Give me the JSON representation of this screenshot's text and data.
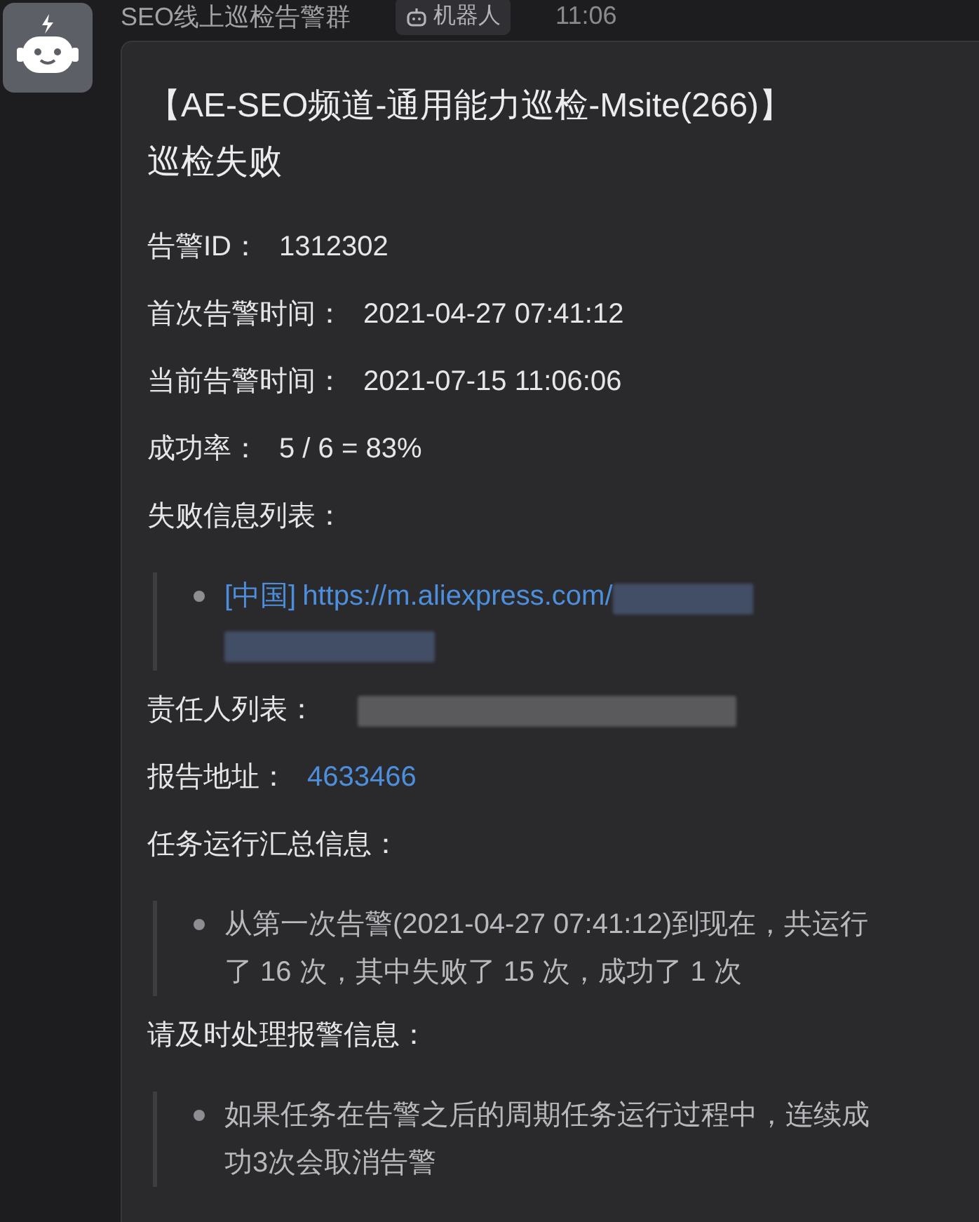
{
  "group": {
    "name": "SEO线上巡检告警群",
    "badge": "机器人",
    "time": "11:06"
  },
  "message": {
    "title_lines": [
      "【AE-SEO频道-通用能力巡检-Msite(266)】",
      "巡检失败"
    ],
    "sections": [
      {
        "kind": "field",
        "label": "告警ID：",
        "value": "1312302"
      },
      {
        "kind": "field",
        "label": "首次告警时间：",
        "value": "2021-04-27 07:41:12"
      },
      {
        "kind": "field",
        "label": "当前告警时间：",
        "value": "2021-07-15 11:06:06"
      },
      {
        "kind": "field",
        "label": "成功率：",
        "value": "5 / 6 = 83%"
      },
      {
        "kind": "list",
        "label": "失败信息列表：",
        "items": [
          {
            "tag": "[中国]",
            "link": "https://m.aliexpress.com/",
            "redacted": true
          }
        ]
      },
      {
        "kind": "redacted",
        "label": "责任人列表："
      },
      {
        "kind": "link",
        "label": "报告地址：",
        "value": "4633466"
      },
      {
        "kind": "list",
        "label": "任务运行汇总信息：",
        "items": [
          {
            "text": "从第一次告警(2021-04-27 07:41:12)到现在，共运行了 16 次，其中失败了 15 次，成功了 1 次"
          }
        ]
      },
      {
        "kind": "list",
        "label": "请及时处理报警信息：",
        "items": [
          {
            "text": "如果任务在告警之后的周期任务运行过程中，连续成功3次会取消告警"
          }
        ]
      }
    ]
  }
}
